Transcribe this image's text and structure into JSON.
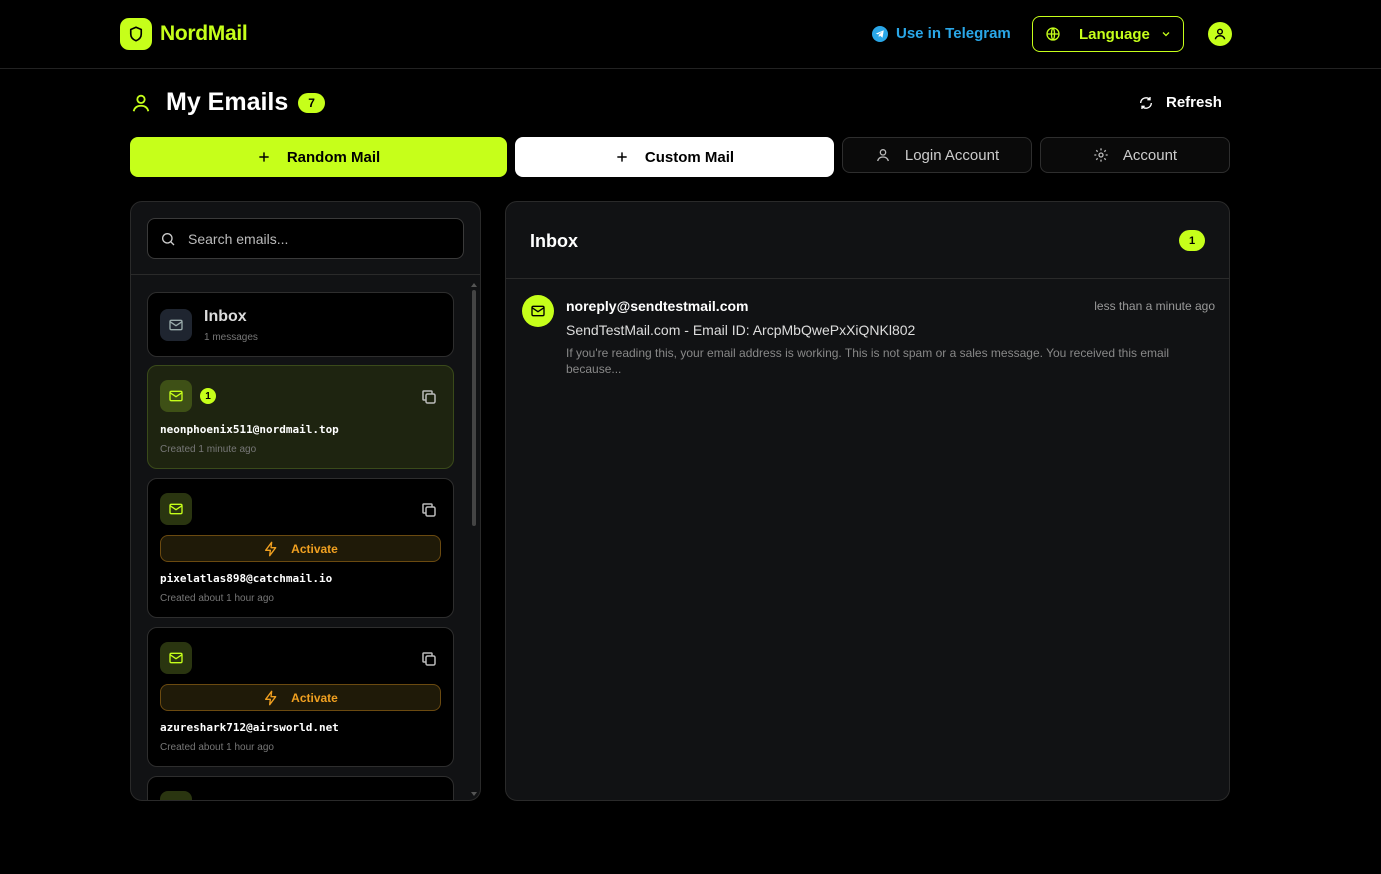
{
  "brand": {
    "name": "NordMail",
    "accent": "#c6ff1a"
  },
  "header": {
    "telegram_label": "Use in Telegram",
    "language_label": "Language"
  },
  "page": {
    "title": "My Emails",
    "count": "7",
    "refresh_label": "Refresh"
  },
  "actions": {
    "random_mail": "Random Mail",
    "custom_mail": "Custom Mail",
    "login_account": "Login Account",
    "account": "Account"
  },
  "sidebar": {
    "search_placeholder": "Search emails...",
    "inbox": {
      "title": "Inbox",
      "sub": "1 messages"
    },
    "activate_label": "Activate",
    "emails": [
      {
        "address": "neonphoenix511@nordmail.top",
        "created": "Created 1 minute ago",
        "unread": "1",
        "active": true
      },
      {
        "address": "pixelatlas898@catchmail.io",
        "created": "Created about 1 hour ago",
        "active": false
      },
      {
        "address": "azureshark712@airsworld.net",
        "created": "Created about 1 hour ago",
        "active": false
      }
    ]
  },
  "inbox": {
    "title": "Inbox",
    "count": "1",
    "messages": [
      {
        "from": "noreply@sendtestmail.com",
        "time": "less than a minute ago",
        "subject": "SendTestMail.com - Email ID: ArcpMbQwePxXiQNKl802",
        "preview": "If you're reading this, your email address is working. This is not spam or a sales message. You received this email because..."
      }
    ]
  }
}
